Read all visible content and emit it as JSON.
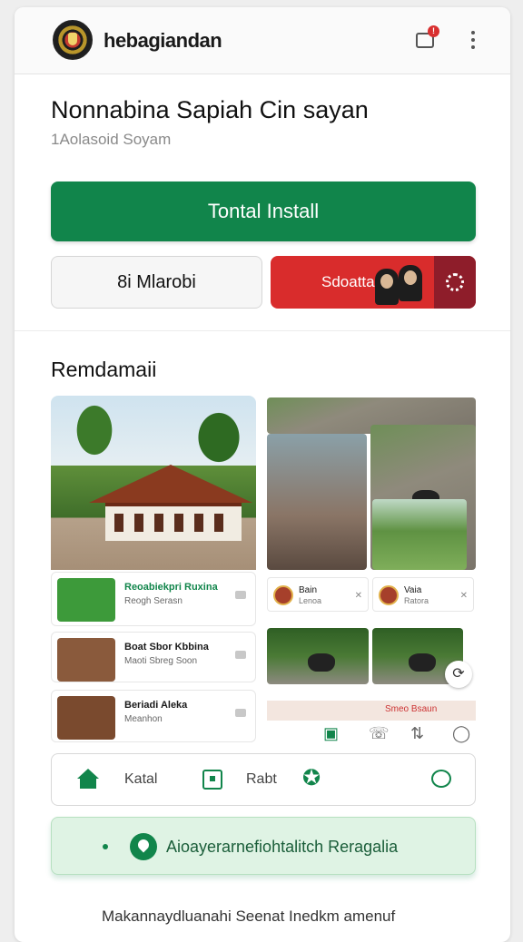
{
  "header": {
    "app_name": "hebagiandan",
    "notification_count": "!"
  },
  "page": {
    "title": "Nonnabina Sapiah Cin sayan",
    "subtitle": "1Aolasoid Soyam"
  },
  "actions": {
    "primary": "Tontal Install",
    "secondary": "8i Mlarobi",
    "red_button": "Sdoattar"
  },
  "section": {
    "title": "Remdamaii"
  },
  "left_list": [
    {
      "title": "Reoabiekpri Ruxina",
      "sub": "Reogh Serasn"
    },
    {
      "title": "Boat Sbor Kbbina",
      "sub": "Maoti Sbreg Soon"
    },
    {
      "title": "Beriadi Aleka",
      "sub": "Meanhon"
    }
  ],
  "right_cards": [
    {
      "title": "Bain",
      "sub": "Lenoa"
    },
    {
      "title": "Vaia",
      "sub": "Ratora"
    }
  ],
  "right_banner": "Smeo Bsaun",
  "bottom_nav": {
    "label1": "Katal",
    "label2": "Rabt"
  },
  "promo": {
    "text": "Aioayerarnefiohtalitch Reragalia"
  },
  "footer": {
    "text": "Makannaydluanahi Seenat Inedkm amenuf"
  },
  "colors": {
    "primary_green": "#11854b",
    "danger_red": "#d92c2c",
    "promo_bg": "#dff3e4"
  }
}
